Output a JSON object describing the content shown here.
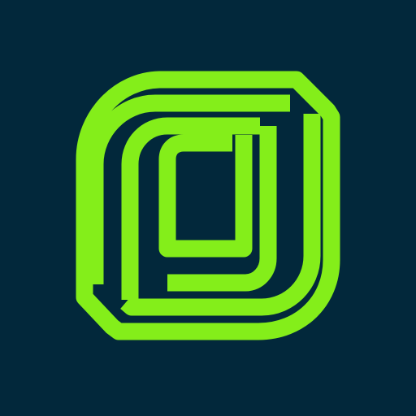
{
  "icon": {
    "name": "green-outlined-d-logo",
    "background_color": "#02283b",
    "stroke_color": "#84ee1a"
  }
}
